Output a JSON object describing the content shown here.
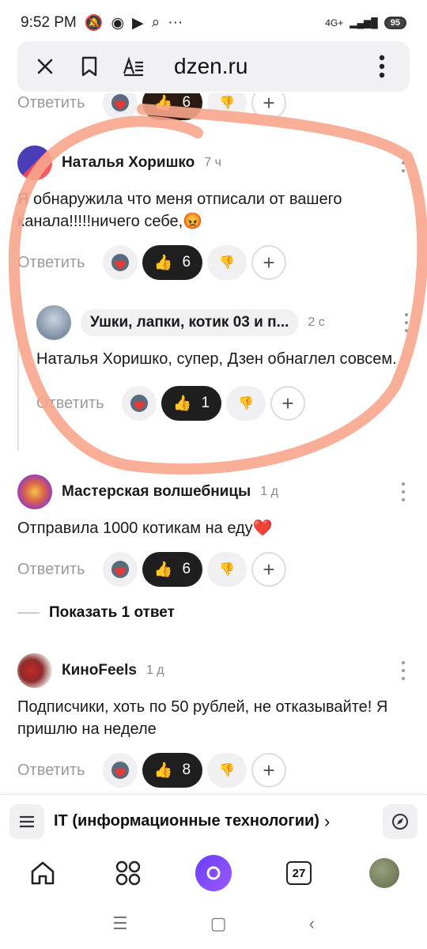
{
  "status_bar": {
    "time": "9:52 PM",
    "icons_left": [
      "mute-icon",
      "whatsapp-icon",
      "youtube-icon",
      "search-icon",
      "more-dots-icon"
    ],
    "network": "4G+",
    "battery": "95"
  },
  "browser": {
    "url": "dzen.ru",
    "close_icon": "close-icon",
    "bookmark_icon": "bookmark-icon",
    "reader_icon": "reader-mode-icon",
    "menu_icon": "more-vertical-icon"
  },
  "comments": [
    {
      "author": "Наталья Хоришко",
      "time": "7 ч",
      "text": "Я обнаружила что меня отписали от вашего канала!!!!!ничего себе,😡",
      "reply_label": "Ответить",
      "likes": "6"
    },
    {
      "author": "Ушки, лапки, котик 03 и п...",
      "time": "2 с",
      "text": "Наталья Хоришко, супер, Дзен обнаглел совсем.",
      "reply_label": "Ответить",
      "likes": "1"
    },
    {
      "author": "Мастерская волшебницы",
      "time": "1 д",
      "text": "Отправила 1000 котикам на еду❤️",
      "reply_label": "Ответить",
      "likes": "6"
    },
    {
      "author": "КиноFeels",
      "time": "1 д",
      "text": "Подписчики, хоть по 50 рублей, не отказывайте! Я пришлю на неделе",
      "reply_label": "Ответить",
      "likes": "8"
    }
  ],
  "partial_top": {
    "reply_label": "Ответить",
    "likes": "6"
  },
  "show_replies": "Показать 1 ответ",
  "topic": {
    "title": "IT (информационные технологии)",
    "chevron": "›"
  },
  "bottom_nav": {
    "calendar_day": "27"
  },
  "colors": {
    "annotation": "#f7a58c",
    "like_pill": "#1f1f1f",
    "alice": "#7b4dff"
  }
}
